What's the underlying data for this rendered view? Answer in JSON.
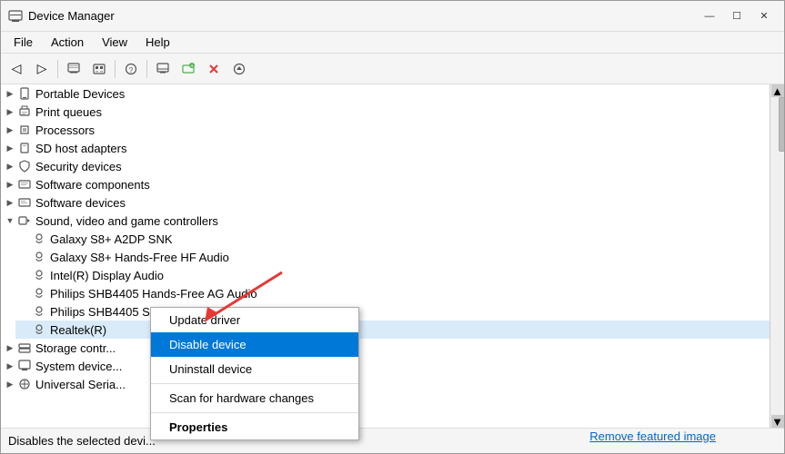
{
  "window": {
    "title": "Device Manager",
    "icon": "device-manager-icon"
  },
  "titlebar": {
    "minimize_label": "—",
    "maximize_label": "☐",
    "close_label": "✕"
  },
  "menubar": {
    "items": [
      {
        "label": "File"
      },
      {
        "label": "Action"
      },
      {
        "label": "View"
      },
      {
        "label": "Help"
      }
    ]
  },
  "toolbar": {
    "buttons": [
      {
        "name": "back-button",
        "icon": "◁"
      },
      {
        "name": "forward-button",
        "icon": "▷"
      },
      {
        "name": "properties-button",
        "icon": "🖥"
      },
      {
        "name": "unknown1-button",
        "icon": "▦"
      },
      {
        "name": "help-button",
        "icon": "?"
      },
      {
        "name": "monitor-button",
        "icon": "🖥"
      },
      {
        "name": "add-button",
        "icon": "✚"
      },
      {
        "name": "remove-button",
        "icon": "✖"
      },
      {
        "name": "update-button",
        "icon": "⬇"
      }
    ]
  },
  "tree": {
    "items": [
      {
        "id": "portable-devices",
        "label": "Portable Devices",
        "indent": 1,
        "expanded": false,
        "has_children": true
      },
      {
        "id": "print-queues",
        "label": "Print queues",
        "indent": 1,
        "expanded": false,
        "has_children": true
      },
      {
        "id": "processors",
        "label": "Processors",
        "indent": 1,
        "expanded": false,
        "has_children": true
      },
      {
        "id": "sd-host",
        "label": "SD host adapters",
        "indent": 1,
        "expanded": false,
        "has_children": true
      },
      {
        "id": "security-devices",
        "label": "Security devices",
        "indent": 1,
        "expanded": false,
        "has_children": true
      },
      {
        "id": "software-components",
        "label": "Software components",
        "indent": 1,
        "expanded": false,
        "has_children": true
      },
      {
        "id": "software-devices",
        "label": "Software devices",
        "indent": 1,
        "expanded": false,
        "has_children": true
      },
      {
        "id": "sound-video",
        "label": "Sound, video and game controllers",
        "indent": 1,
        "expanded": true,
        "has_children": true
      },
      {
        "id": "galaxy-s8-a2dp",
        "label": "Galaxy S8+ A2DP SNK",
        "indent": 2,
        "expanded": false,
        "has_children": false
      },
      {
        "id": "galaxy-s8-hf",
        "label": "Galaxy S8+ Hands-Free HF Audio",
        "indent": 2,
        "expanded": false,
        "has_children": false
      },
      {
        "id": "intel-display-audio",
        "label": "Intel(R) Display Audio",
        "indent": 2,
        "expanded": false,
        "has_children": false
      },
      {
        "id": "philips-ag-audio",
        "label": "Philips SHB4405 Hands-Free AG Audio",
        "indent": 2,
        "expanded": false,
        "has_children": false
      },
      {
        "id": "philips-stereo",
        "label": "Philips SHB4405 Stereo",
        "indent": 2,
        "expanded": false,
        "has_children": false
      },
      {
        "id": "realtek",
        "label": "Realtek(R)",
        "indent": 2,
        "expanded": false,
        "has_children": false,
        "selected": true
      },
      {
        "id": "storage-controllers",
        "label": "Storage contr...",
        "indent": 1,
        "expanded": false,
        "has_children": true
      },
      {
        "id": "system-devices",
        "label": "System device...",
        "indent": 1,
        "expanded": false,
        "has_children": true
      },
      {
        "id": "universal-serial",
        "label": "Universal Seria...",
        "indent": 1,
        "expanded": false,
        "has_children": true
      }
    ]
  },
  "context_menu": {
    "items": [
      {
        "id": "update-driver",
        "label": "Update driver",
        "type": "normal"
      },
      {
        "id": "disable-device",
        "label": "Disable device",
        "type": "active"
      },
      {
        "id": "uninstall-device",
        "label": "Uninstall device",
        "type": "normal"
      },
      {
        "id": "sep1",
        "type": "separator"
      },
      {
        "id": "scan-hardware",
        "label": "Scan for hardware changes",
        "type": "normal"
      },
      {
        "id": "sep2",
        "type": "separator"
      },
      {
        "id": "properties",
        "label": "Properties",
        "type": "bold"
      }
    ]
  },
  "statusbar": {
    "text": "Disables the selected devi..."
  },
  "featured": {
    "remove_label": "Remove featured image"
  }
}
